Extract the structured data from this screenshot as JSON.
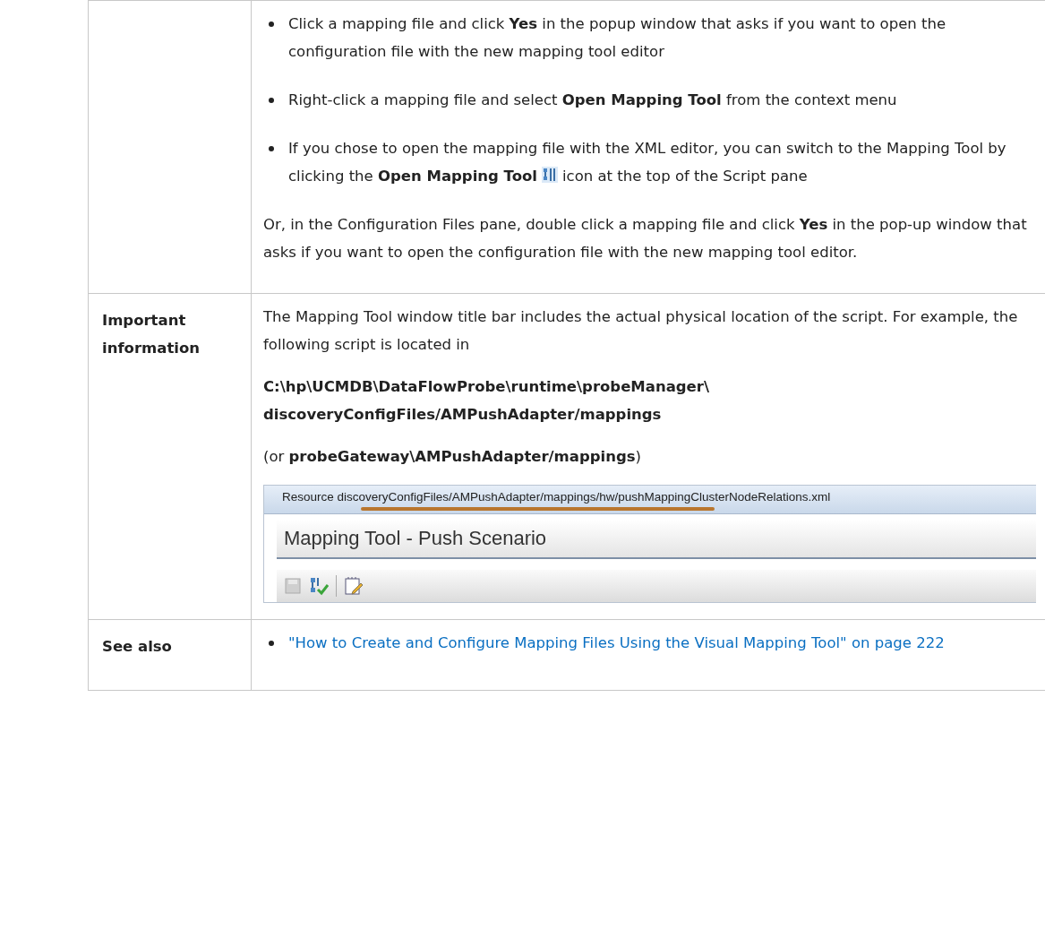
{
  "rows": [
    {
      "label": "",
      "blocks": [
        {
          "kind": "bullets",
          "items": [
            {
              "text": "Click a mapping file and click **Yes** in the popup window that asks if you want to open the configuration file with the new mapping tool editor"
            },
            {
              "text": "Right-click a mapping file and select **Open Mapping Tool** from the context menu"
            },
            {
              "text": "If you chose to open the mapping file with the XML editor, you can switch to the Mapping Tool by clicking the **Open Mapping Tool**",
              "text_after": "icon at the top of the Script pane"
            }
          ]
        },
        {
          "kind": "paragraph",
          "text": "Or, in the Configuration Files pane, double click a mapping file and click **Yes** in the pop-up window that asks if you want to open the configuration file with the new mapping tool editor."
        }
      ]
    },
    {
      "label": "Important information",
      "blocks": [
        {
          "kind": "paragraph",
          "text": "The Mapping Tool window title bar includes the actual physical location of the script. For example, the following script is located in"
        },
        {
          "kind": "paragraph",
          "text": "**C:\\hp\\UCMDB\\DataFlowProbe\\runtime\\probeManager\\ discoveryConfigFiles/AMPushAdapter/mappings**"
        },
        {
          "kind": "paragraph",
          "text": "(or **probeGateway\\AMPushAdapter/mappings**)"
        },
        {
          "kind": "screenshot",
          "resource": "Resource discoveryConfigFiles/AMPushAdapter/mappings/hw/pushMappingClusterNodeRelations.xml",
          "title": "Mapping Tool - Push Scenario"
        }
      ]
    },
    {
      "label": "See also",
      "blocks": [
        {
          "kind": "links",
          "items": [
            {
              "text": "\"How to Create and Configure Mapping Files Using the Visual Mapping Tool\" on page 222"
            }
          ]
        }
      ]
    }
  ]
}
